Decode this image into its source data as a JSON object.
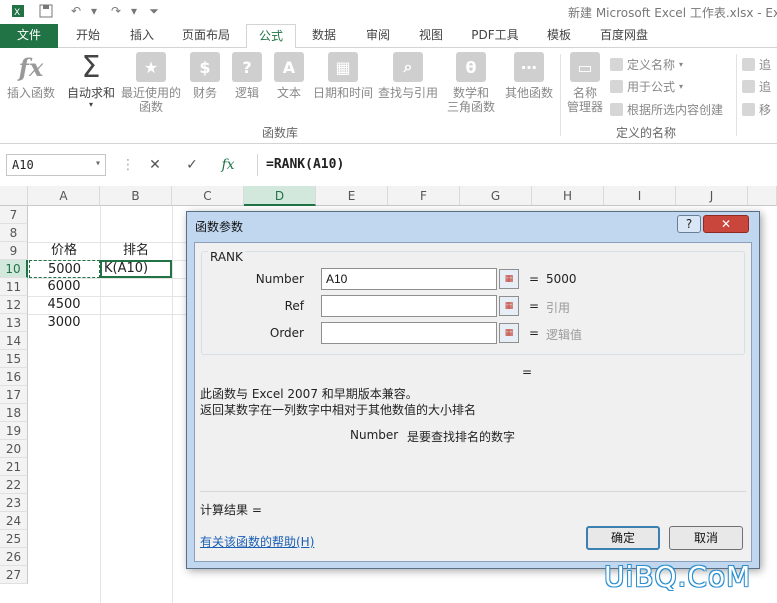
{
  "titlebar": {
    "title": "新建 Microsoft Excel 工作表.xlsx - Ex"
  },
  "tabs": [
    "文件",
    "开始",
    "插入",
    "页面布局",
    "公式",
    "数据",
    "审阅",
    "视图",
    "PDF工具",
    "模板",
    "百度网盘"
  ],
  "ribbon": {
    "function_library": {
      "buttons": [
        "插入函数",
        "自动求和",
        "最近使用的\n函数",
        "财务",
        "逻辑",
        "文本",
        "日期和时间",
        "查找与引用",
        "数学和\n三角函数",
        "其他函数"
      ],
      "group_label": "函数库"
    },
    "defined_names": {
      "manager_label": "名称\n管理器",
      "commands": [
        "定义名称",
        "用于公式",
        "根据所选内容创建"
      ],
      "group_label": "定义的名称"
    },
    "audit": {
      "commands": [
        "追",
        "追",
        "移"
      ]
    }
  },
  "formula_bar": {
    "name_box": "A10",
    "fx": "fx",
    "formula": "=RANK(A10)"
  },
  "grid": {
    "columns": [
      "A",
      "B",
      "C",
      "D",
      "E",
      "F",
      "G",
      "H",
      "I",
      "J"
    ],
    "rows": [
      "7",
      "8",
      "9",
      "10",
      "11",
      "12",
      "13",
      "14",
      "15",
      "16",
      "17",
      "18",
      "19",
      "20",
      "21",
      "22",
      "23",
      "24",
      "25",
      "26",
      "27"
    ],
    "cells": {
      "a9": "价格",
      "b9": "排名",
      "a10": "5000",
      "b10": "K(A10)",
      "a11": "6000",
      "a12": "4500",
      "a13": "3000"
    }
  },
  "dialog": {
    "title": "函数参数",
    "help_btn": "?",
    "close_btn": "✕",
    "function_name": "RANK",
    "args": [
      {
        "label": "Number",
        "value": "A10",
        "equals": "=",
        "result": "5000"
      },
      {
        "label": "Ref",
        "value": "",
        "equals": "=",
        "result": "引用"
      },
      {
        "label": "Order",
        "value": "",
        "equals": "=",
        "result": "逻辑值"
      }
    ],
    "overall_equals": "=",
    "desc_line1": "此函数与 Excel 2007 和早期版本兼容。",
    "desc_line2": "返回某数字在一列数字中相对于其他数值的大小排名",
    "param_name": "Number",
    "param_desc": "是要查找排名的数字",
    "result_label": "计算结果 =",
    "help_link": "有关该函数的帮助(H)",
    "ok": "确定",
    "cancel": "取消"
  },
  "watermark": "UiBQ.CoM"
}
